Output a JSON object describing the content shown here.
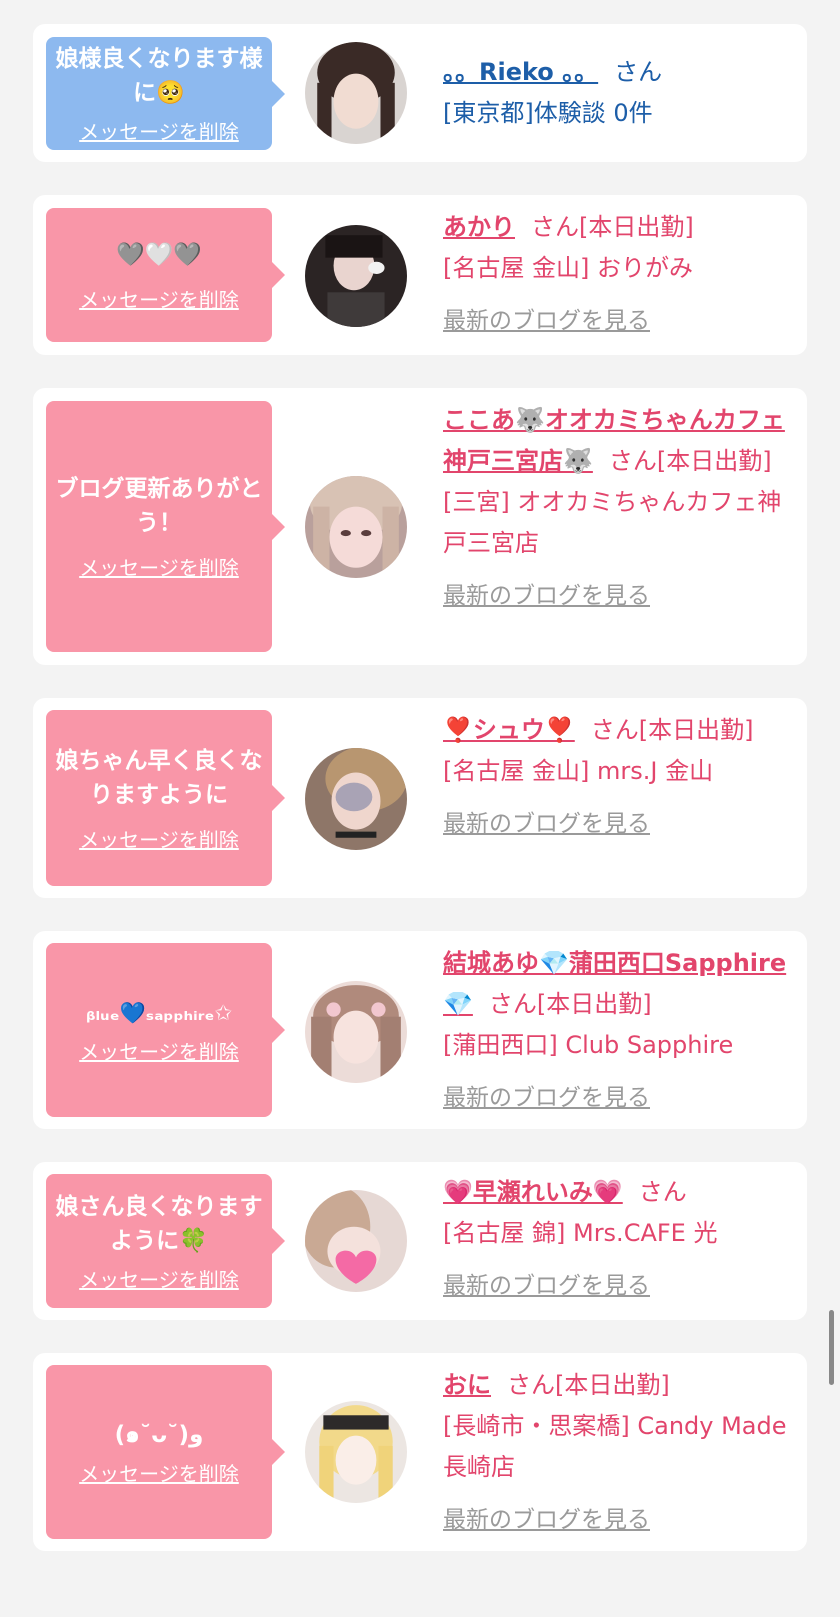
{
  "items": [
    {
      "message": "娘様良くなります様に🥺",
      "delete_label": "メッセージを削除",
      "name": "。。Rieko 。。",
      "suffix": "さん",
      "details": [
        "[東京都]体験談 0件"
      ],
      "blog_label": "",
      "theme": "blue"
    },
    {
      "message": "🩶🤍🩶",
      "delete_label": "メッセージを削除",
      "name": "あかり",
      "suffix": "さん[本日出勤]",
      "details": [
        "[名古屋 金山] おりがみ"
      ],
      "blog_label": "最新のブログを見る",
      "theme": "pink"
    },
    {
      "message": "ブログ更新ありがとう！",
      "delete_label": "メッセージを削除",
      "name": "ここあ🐺オオカミちゃんカフェ神戸三宮店🐺",
      "suffix": "さん[本日出勤]",
      "details": [
        "[三宮] オオカミちゃんカフェ神戸三宮店"
      ],
      "blog_label": "最新のブログを見る",
      "theme": "pink"
    },
    {
      "message": "娘ちゃん早く良くなりますように",
      "delete_label": "メッセージを削除",
      "name": "❣️シュウ❣️",
      "suffix": "さん[本日出勤]",
      "details": [
        "[名古屋 金山] mrs.J 金山"
      ],
      "blog_label": "最新のブログを見る",
      "theme": "pink"
    },
    {
      "message": "ᵦₗᵤₑ💙ₛₐₚₚₕᵢᵣₑ✩",
      "delete_label": "メッセージを削除",
      "name": "結城あゆ💎蒲田西口Sapphire💎",
      "suffix": "さん[本日出勤]",
      "details": [
        "[蒲田西口] Club Sapphire"
      ],
      "blog_label": "最新のブログを見る",
      "theme": "pink"
    },
    {
      "message": "娘さん良くなりますように🍀",
      "delete_label": "メッセージを削除",
      "name": "💗早瀬れいみ💗",
      "suffix": "さん",
      "details": [
        "[名古屋 錦] Mrs.CAFE 光"
      ],
      "blog_label": "最新のブログを見る",
      "theme": "pink"
    },
    {
      "message": "(๑˘ᴗ˘)و",
      "delete_label": "メッセージを削除",
      "name": "おに",
      "suffix": "さん[本日出勤]",
      "details": [
        "[長崎市・思案橋] Candy Made 長崎店"
      ],
      "blog_label": "最新のブログを見る",
      "theme": "pink"
    }
  ],
  "colors": {
    "pink_bubble": "#f996a8",
    "blue_bubble": "#8db9ef",
    "pink_text": "#e2456c",
    "blue_text": "#1d5ea8",
    "link_gray": "#9a9a9a",
    "background": "#f3f3f3"
  }
}
